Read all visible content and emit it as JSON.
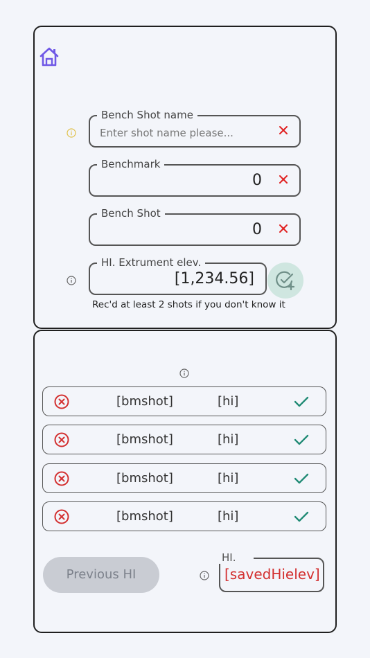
{
  "colors": {
    "accent": "#6f58e6",
    "clear": "#e02020",
    "check": "#1f8a74",
    "delete": "#d32f2f",
    "info_warn": "#e0c14a",
    "info": "#666666"
  },
  "icons": {
    "home": "home-icon",
    "info": "info-icon",
    "clear": "close-icon",
    "add": "check-plus-icon",
    "delete": "cancel-circle-icon",
    "confirm": "check-icon"
  },
  "form": {
    "shot_name": {
      "label": "Bench Shot name",
      "placeholder": "Enter shot name please...",
      "value": ""
    },
    "benchmark": {
      "label": "Benchmark",
      "value": "0"
    },
    "bench_shot": {
      "label": "Bench Shot",
      "value": "0"
    },
    "hi_elev": {
      "label": "HI. Extrument elev.",
      "value": "[1,234.56]"
    },
    "hint": "Rec'd at least 2 shots if you don't know it"
  },
  "shots": [
    {
      "bmshot": "[bmshot]",
      "hi": "[hi]"
    },
    {
      "bmshot": "[bmshot]",
      "hi": "[hi]"
    },
    {
      "bmshot": "[bmshot]",
      "hi": "[hi]"
    },
    {
      "bmshot": "[bmshot]",
      "hi": "[hi]"
    }
  ],
  "footer": {
    "previous_label": "Previous HI",
    "saved_label": "HI.",
    "saved_value": "[savedHielev]"
  }
}
